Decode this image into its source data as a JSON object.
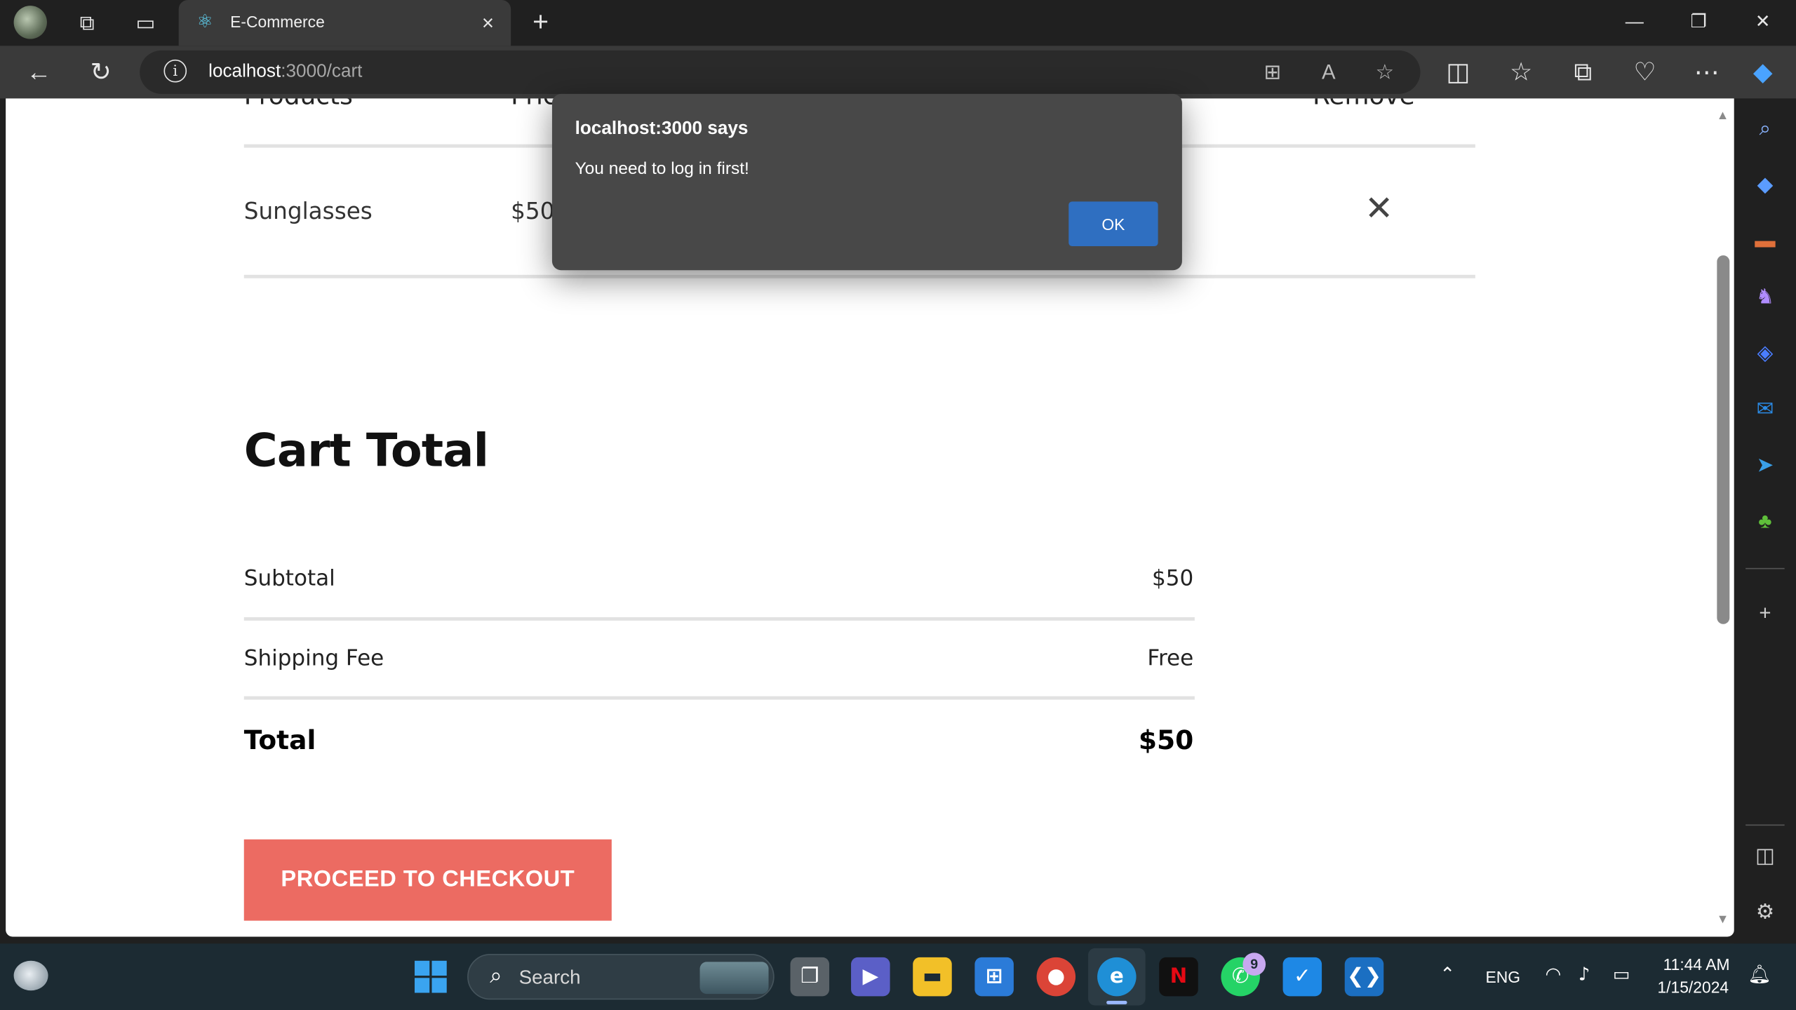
{
  "browser": {
    "tab_title": "E-Commerce",
    "url_host": "localhost",
    "url_path": ":3000/cart"
  },
  "cart": {
    "headers": {
      "products": "Products",
      "price": "Price",
      "remove": "Remove"
    },
    "items": [
      {
        "name": "Sunglasses",
        "price": "$50"
      }
    ]
  },
  "totals": {
    "title": "Cart Total",
    "subtotal_label": "Subtotal",
    "subtotal_value": "$50",
    "shipping_label": "Shipping Fee",
    "shipping_value": "Free",
    "total_label": "Total",
    "total_value": "$50",
    "checkout_label": "PROCEED TO CHECKOUT",
    "checkout_color": "#ec6b62"
  },
  "alert": {
    "title": "localhost:3000 says",
    "message": "You need to log in first!",
    "ok_label": "OK"
  },
  "taskbar": {
    "search_placeholder": "Search",
    "whatsapp_badge": "9",
    "language": "ENG",
    "time": "11:44 AM",
    "date": "1/15/2024"
  },
  "icons": {
    "accent": "#2f6fc1",
    "sidebar": [
      "search-icon",
      "tag-icon",
      "briefcase-icon",
      "chess-icon",
      "copilot-icon",
      "outlook-icon",
      "send-icon",
      "tree-icon",
      "add-icon",
      "sidebar-toggle-icon",
      "settings-icon"
    ]
  }
}
